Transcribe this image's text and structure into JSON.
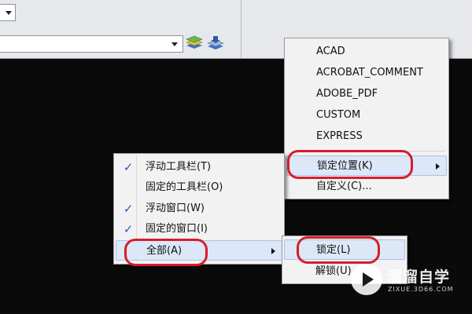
{
  "toolbar": {
    "layer_combo_value": "",
    "icons": [
      "layer-states-icon",
      "layer-previous-icon"
    ]
  },
  "toolbars_menu": {
    "items": [
      {
        "label": "ACAD"
      },
      {
        "label": "ACROBAT_COMMENT"
      },
      {
        "label": "ADOBE_PDF"
      },
      {
        "label": "CUSTOM"
      },
      {
        "label": "EXPRESS"
      },
      {
        "label": "锁定位置(K)"
      },
      {
        "label": "自定义(C)..."
      }
    ]
  },
  "lock_menu": {
    "items": [
      {
        "label": "浮动工具栏(T)",
        "checked": true
      },
      {
        "label": "固定的工具栏(O)",
        "checked": false
      },
      {
        "label": "浮动窗口(W)",
        "checked": true
      },
      {
        "label": "固定的窗口(I)",
        "checked": true
      },
      {
        "label": "全部(A)",
        "checked": false,
        "has_submenu": true
      }
    ],
    "check_glyph": "✓"
  },
  "all_submenu": {
    "items": [
      {
        "label": "锁定(L)"
      },
      {
        "label": "解锁(U)"
      }
    ]
  },
  "annotation_color": "#d61e2a",
  "watermark": {
    "logo": "play-logo-icon",
    "brand": "溜溜自学",
    "site": "ZIXUE.3D66.COM"
  }
}
